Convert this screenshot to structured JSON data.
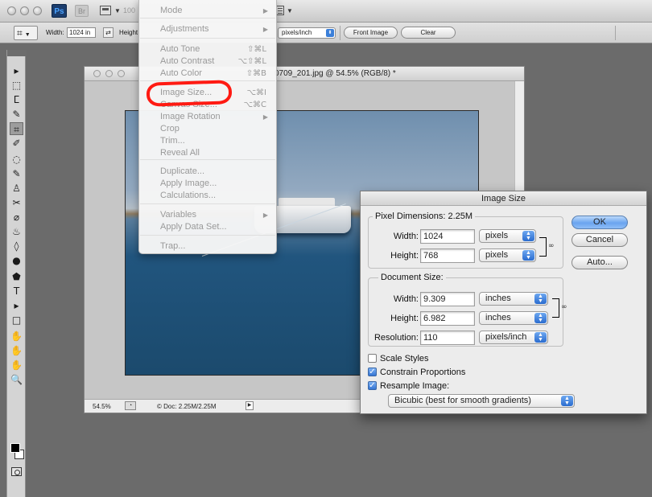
{
  "appbar": {
    "ps_badge": "Ps",
    "br_badge": "Br",
    "zoom_ghost": "100"
  },
  "options_bar": {
    "width_label": "Width:",
    "width_value": "1024 in",
    "swap_glyph": "⇄",
    "height_label": "Height",
    "resolution_unit": "pixels/inch",
    "front_image_label": "Front Image",
    "clear_label": "Clear"
  },
  "tools": {
    "glyphs": [
      "▸",
      "⬚",
      "ⵎ",
      "✎",
      "⌗",
      "✐",
      "◌",
      "✎",
      "♙",
      "✂",
      "⌀",
      "♨",
      "◊",
      "●",
      "⬟",
      "T",
      "▸",
      "□",
      "✋",
      "✋",
      "✋",
      "🔍"
    ]
  },
  "document": {
    "title": "0709_201.jpg @ 54.5% (RGB/8) *",
    "zoom": "54.5%",
    "doc_info": "© Doc: 2.25M/2.25M",
    "status_arrow": "▶"
  },
  "image_menu": {
    "items": [
      {
        "label": "Mode",
        "shortcut": "",
        "submenu": true
      },
      {
        "label": "Adjustments",
        "shortcut": "",
        "submenu": true
      },
      {
        "label": "Auto Tone",
        "shortcut": "⇧⌘L",
        "submenu": false
      },
      {
        "label": "Auto Contrast",
        "shortcut": "⌥⇧⌘L",
        "submenu": false
      },
      {
        "label": "Auto Color",
        "shortcut": "⇧⌘B",
        "submenu": false
      },
      {
        "label": "Image Size...",
        "shortcut": "⌥⌘I",
        "submenu": false
      },
      {
        "label": "Canvas Size...",
        "shortcut": "⌥⌘C",
        "submenu": false
      },
      {
        "label": "Image Rotation",
        "shortcut": "",
        "submenu": true
      },
      {
        "label": "Crop",
        "shortcut": "",
        "submenu": false
      },
      {
        "label": "Trim...",
        "shortcut": "",
        "submenu": false
      },
      {
        "label": "Reveal All",
        "shortcut": "",
        "submenu": false
      },
      {
        "label": "Duplicate...",
        "shortcut": "",
        "submenu": false
      },
      {
        "label": "Apply Image...",
        "shortcut": "",
        "submenu": false
      },
      {
        "label": "Calculations...",
        "shortcut": "",
        "submenu": false
      },
      {
        "label": "Variables",
        "shortcut": "",
        "submenu": true
      },
      {
        "label": "Apply Data Set...",
        "shortcut": "",
        "submenu": false
      },
      {
        "label": "Trap...",
        "shortcut": "",
        "submenu": false
      }
    ]
  },
  "dialog": {
    "title": "Image Size",
    "pixel_dimensions": {
      "label": "Pixel Dimensions:  2.25M",
      "width_label": "Width:",
      "width_value": "1024",
      "width_unit": "pixels",
      "height_label": "Height:",
      "height_value": "768",
      "height_unit": "pixels"
    },
    "document_size": {
      "label": "Document Size:",
      "width_label": "Width:",
      "width_value": "9.309",
      "width_unit": "inches",
      "height_label": "Height:",
      "height_value": "6.982",
      "height_unit": "inches",
      "resolution_label": "Resolution:",
      "resolution_value": "110",
      "resolution_unit": "pixels/inch"
    },
    "scale_styles": {
      "label": "Scale Styles",
      "checked": false
    },
    "constrain_proportions": {
      "label": "Constrain Proportions",
      "checked": true
    },
    "resample_image": {
      "label": "Resample Image:",
      "checked": true
    },
    "resample_method": "Bicubic (best for smooth gradients)",
    "ok_label": "OK",
    "cancel_label": "Cancel",
    "auto_label": "Auto..."
  },
  "colors": {
    "workspace": "#6b6b6b",
    "annotation_red": "#ff1a12",
    "accent_blue": "#3b7fd9"
  }
}
